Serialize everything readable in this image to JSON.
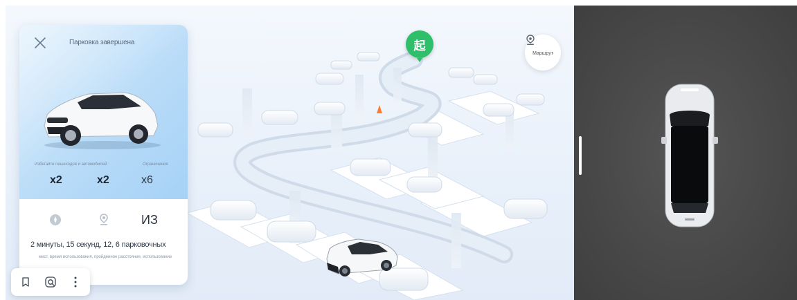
{
  "panel": {
    "title": "Парковка завершена",
    "stats": [
      {
        "label": "Избегайте пешеходов и автомобилей",
        "value": "x2"
      },
      {
        "label": "",
        "value": "x2"
      },
      {
        "label": "Ограничения",
        "value": "x6"
      }
    ],
    "iz_label": "ИЗ",
    "summary": "2 минуты, 15 секунд, 12, 6 парковочных",
    "summary_sub": "мест, время использования, пройденное расстояние, использование"
  },
  "map": {
    "start_marker": "起",
    "route_label": "Маршрут"
  },
  "toolbar": {
    "icons": [
      "bookmark-icon",
      "camera-scan-icon",
      "more-vertical-icon"
    ]
  },
  "colors": {
    "accent_green": "#2fbf6a",
    "panel_blue": "#b9dcf8",
    "camera_ground": "#4b4b4b"
  }
}
